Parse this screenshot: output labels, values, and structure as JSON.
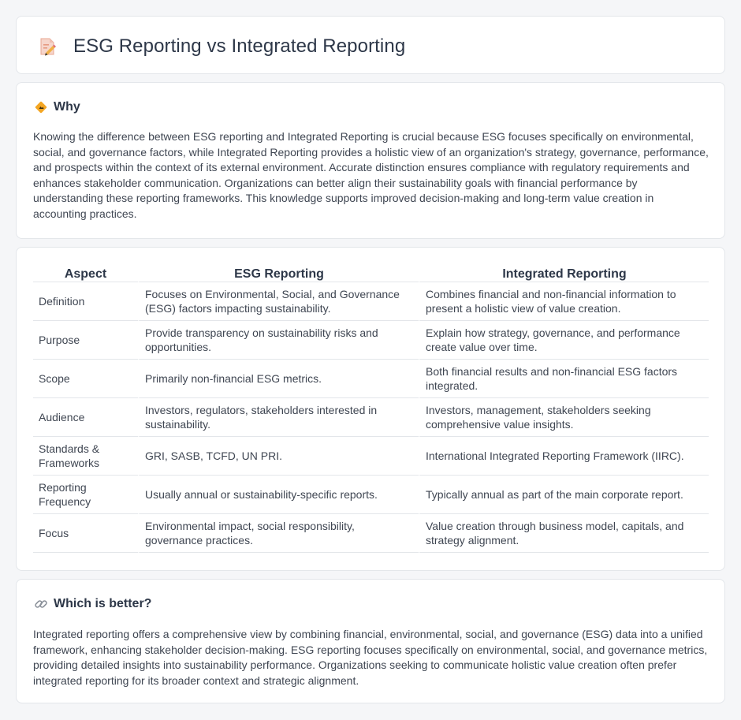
{
  "header": {
    "title": "ESG Reporting vs Integrated Reporting",
    "icon": "document-pencil-icon"
  },
  "why": {
    "icon": "warning-sign-icon",
    "heading": "Why",
    "text": "Knowing the difference between ESG reporting and Integrated Reporting is crucial because ESG focuses specifically on environmental, social, and governance factors, while Integrated Reporting provides a holistic view of an organization's strategy, governance, performance, and prospects within the context of its external environment. Accurate distinction ensures compliance with regulatory requirements and enhances stakeholder communication. Organizations can better align their sustainability goals with financial performance by understanding these reporting frameworks. This knowledge supports improved decision-making and long-term value creation in accounting practices."
  },
  "table": {
    "headers": [
      "Aspect",
      "ESG Reporting",
      "Integrated Reporting"
    ],
    "rows": [
      [
        "Definition",
        "Focuses on Environmental, Social, and Governance (ESG) factors impacting sustainability.",
        "Combines financial and non-financial information to present a holistic view of value creation."
      ],
      [
        "Purpose",
        "Provide transparency on sustainability risks and opportunities.",
        "Explain how strategy, governance, and performance create value over time."
      ],
      [
        "Scope",
        "Primarily non-financial ESG metrics.",
        "Both financial results and non-financial ESG factors integrated."
      ],
      [
        "Audience",
        "Investors, regulators, stakeholders interested in sustainability.",
        "Investors, management, stakeholders seeking comprehensive value insights."
      ],
      [
        "Standards & Frameworks",
        "GRI, SASB, TCFD, UN PRI.",
        "International Integrated Reporting Framework (IIRC)."
      ],
      [
        "Reporting Frequency",
        "Usually annual or sustainability-specific reports.",
        "Typically annual as part of the main corporate report."
      ],
      [
        "Focus",
        "Environmental impact, social responsibility, governance practices.",
        "Value creation through business model, capitals, and strategy alignment."
      ]
    ]
  },
  "better": {
    "icon": "link-icon",
    "heading": "Which is better?",
    "text": "Integrated reporting offers a comprehensive view by combining financial, environmental, social, and governance (ESG) data into a unified framework, enhancing stakeholder decision-making. ESG reporting focuses specifically on environmental, social, and governance metrics, providing detailed insights into sustainability performance. Organizations seeking to communicate holistic value creation often prefer integrated reporting for its broader context and strategic alignment."
  },
  "colors": {
    "background": "#f5f6f8",
    "card": "#ffffff",
    "border": "#e3e6ea",
    "text": "#3f4652",
    "heading": "#2d3748"
  }
}
